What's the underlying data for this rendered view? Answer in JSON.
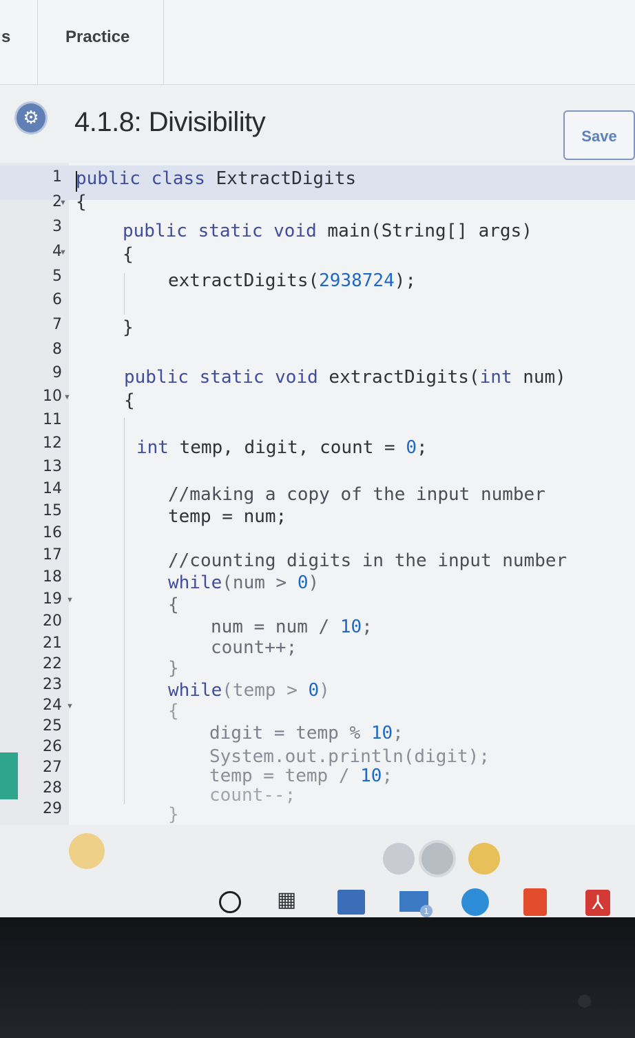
{
  "tabs": {
    "previous_fragment": "s",
    "practice": "Practice"
  },
  "header": {
    "title": "4.1.8: Divisibility",
    "save_label": "Save"
  },
  "editor": {
    "line_numbers": [
      "1",
      "2",
      "3",
      "4",
      "5",
      "6",
      "7",
      "8",
      "9",
      "10",
      "11",
      "12",
      "13",
      "14",
      "15",
      "16",
      "17",
      "18",
      "19",
      "20",
      "21",
      "22",
      "23",
      "24",
      "25",
      "26",
      "27",
      "28",
      "29"
    ],
    "lines": [
      "public class ExtractDigits",
      "{",
      "public static void main(String[] args)",
      "{",
      "extractDigits(2938724);",
      "",
      "}",
      "",
      "public static void extractDigits(int num)",
      "{",
      "",
      "int temp, digit, count = 0;",
      "",
      "//making a copy of the input number",
      "temp = num;",
      "",
      "//counting digits in the input number",
      "while(num > 0)",
      "{",
      "num = num / 10;",
      "count++;",
      "}",
      "while(temp > 0)",
      "{",
      "digit = temp % 10;",
      "System.out.println(digit);",
      "temp = temp / 10;",
      "count--;",
      "}"
    ]
  },
  "taskbar": {
    "mail_badge": "1"
  },
  "colors": {
    "keyword": "#3f4d9a",
    "number": "#1f69c4",
    "comment": "#4a4e57",
    "accent": "#5d7fba",
    "gutter_accent": "#2fa58e"
  },
  "icons": [
    "settings-icon",
    "start-circle-icon",
    "task-view-icon",
    "store-icon",
    "mail-icon",
    "edge-icon",
    "office-icon",
    "pdf-icon"
  ]
}
